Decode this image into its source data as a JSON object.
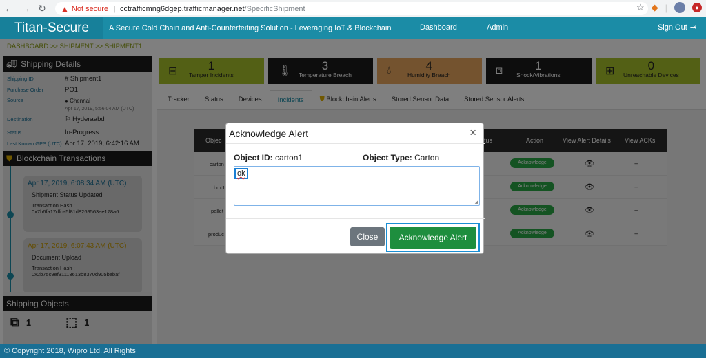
{
  "browser": {
    "not_secure": "Not secure",
    "url_host": "cctrafficmng6dgep.trafficmanager.net",
    "url_path": "/SpecificShipment"
  },
  "header": {
    "brand": "Titan-Secure",
    "tagline": "A Secure Cold Chain and Anti-Counterfeiting Solution - Leveraging IoT & Blockchain",
    "nav_dashboard": "Dashboard",
    "nav_admin": "Admin",
    "signout": "Sign Out"
  },
  "breadcrumb": "DASHBOARD >> SHIPMENT >> SHIPMENT1",
  "shipping_details": {
    "title": "Shipping Details",
    "rows": [
      {
        "label": "Shipping ID",
        "value": "# Shipment1"
      },
      {
        "label": "Purchase Order",
        "value": "PO1"
      },
      {
        "label": "Source",
        "value": "Chennai",
        "sub": "Apr 17, 2019, 5:56:04 AM (UTC)"
      },
      {
        "label": "Destination",
        "value": "Hyderaabd"
      },
      {
        "label": "Status",
        "value": "In-Progress"
      },
      {
        "label": "Last Known GPS (UTC)",
        "value": "Apr 17, 2019, 6:42:16 AM"
      }
    ]
  },
  "blockchain": {
    "title": "Blockchain Transactions",
    "items": [
      {
        "time": "Apr 17, 2019, 6:08:34 AM (UTC)",
        "title": "Shipment Status Updated",
        "hash_label": "Transaction Hash :",
        "hash": "0x7b6fa17dfca5f81d8269563ee178a6"
      },
      {
        "time": "Apr 17, 2019, 6:07:43 AM (UTC)",
        "title": "Document Upload",
        "hash_label": "Transaction Hash :",
        "hash": "0x2b75c9ef31113613b8370d905bebaf"
      }
    ]
  },
  "shipping_objects": {
    "title": "Shipping Objects",
    "counts": [
      "1",
      "1"
    ]
  },
  "tiles": [
    {
      "count": "1",
      "label": "Tamper Incidents",
      "color": "#a6c12a"
    },
    {
      "count": "3",
      "label": "Temperature Breach",
      "color": "#1a1a1a"
    },
    {
      "count": "4",
      "label": "Humidity Breach",
      "color": "#e8a65e"
    },
    {
      "count": "1",
      "label": "Shock/Vibrations",
      "color": "#1a1a1a"
    },
    {
      "count": "0",
      "label": "Unreachable Devices",
      "color": "#a6c12a"
    }
  ],
  "tabs": [
    "Tracker",
    "Status",
    "Devices",
    "Incidents",
    "Blockchain Alerts",
    "Stored Sensor Data",
    "Stored Sensor Alerts"
  ],
  "table": {
    "headers": {
      "object": "Objec",
      "status": "tus",
      "action": "Action",
      "view_details": "View Alert Details",
      "view_acks": "View ACKs"
    },
    "rows": [
      {
        "object": "carton",
        "action": "Acknowledge",
        "acks": "--"
      },
      {
        "object": "box1",
        "action": "Acknowledge",
        "acks": "--"
      },
      {
        "object": "pallet",
        "action": "Acknowledge",
        "acks": "--"
      },
      {
        "object": "produc",
        "action": "Acknowledge",
        "acks": "--"
      }
    ]
  },
  "modal": {
    "title": "Acknowledge Alert",
    "close_glyph": "×",
    "object_id_label": "Object ID:",
    "object_id_value": "carton1",
    "object_type_label": "Object Type:",
    "object_type_value": "Carton",
    "comment_value": "ok",
    "close_button": "Close",
    "ack_button": "Acknowledge Alert"
  },
  "footer": "© Copyright 2018, Wipro Ltd. All Rights"
}
